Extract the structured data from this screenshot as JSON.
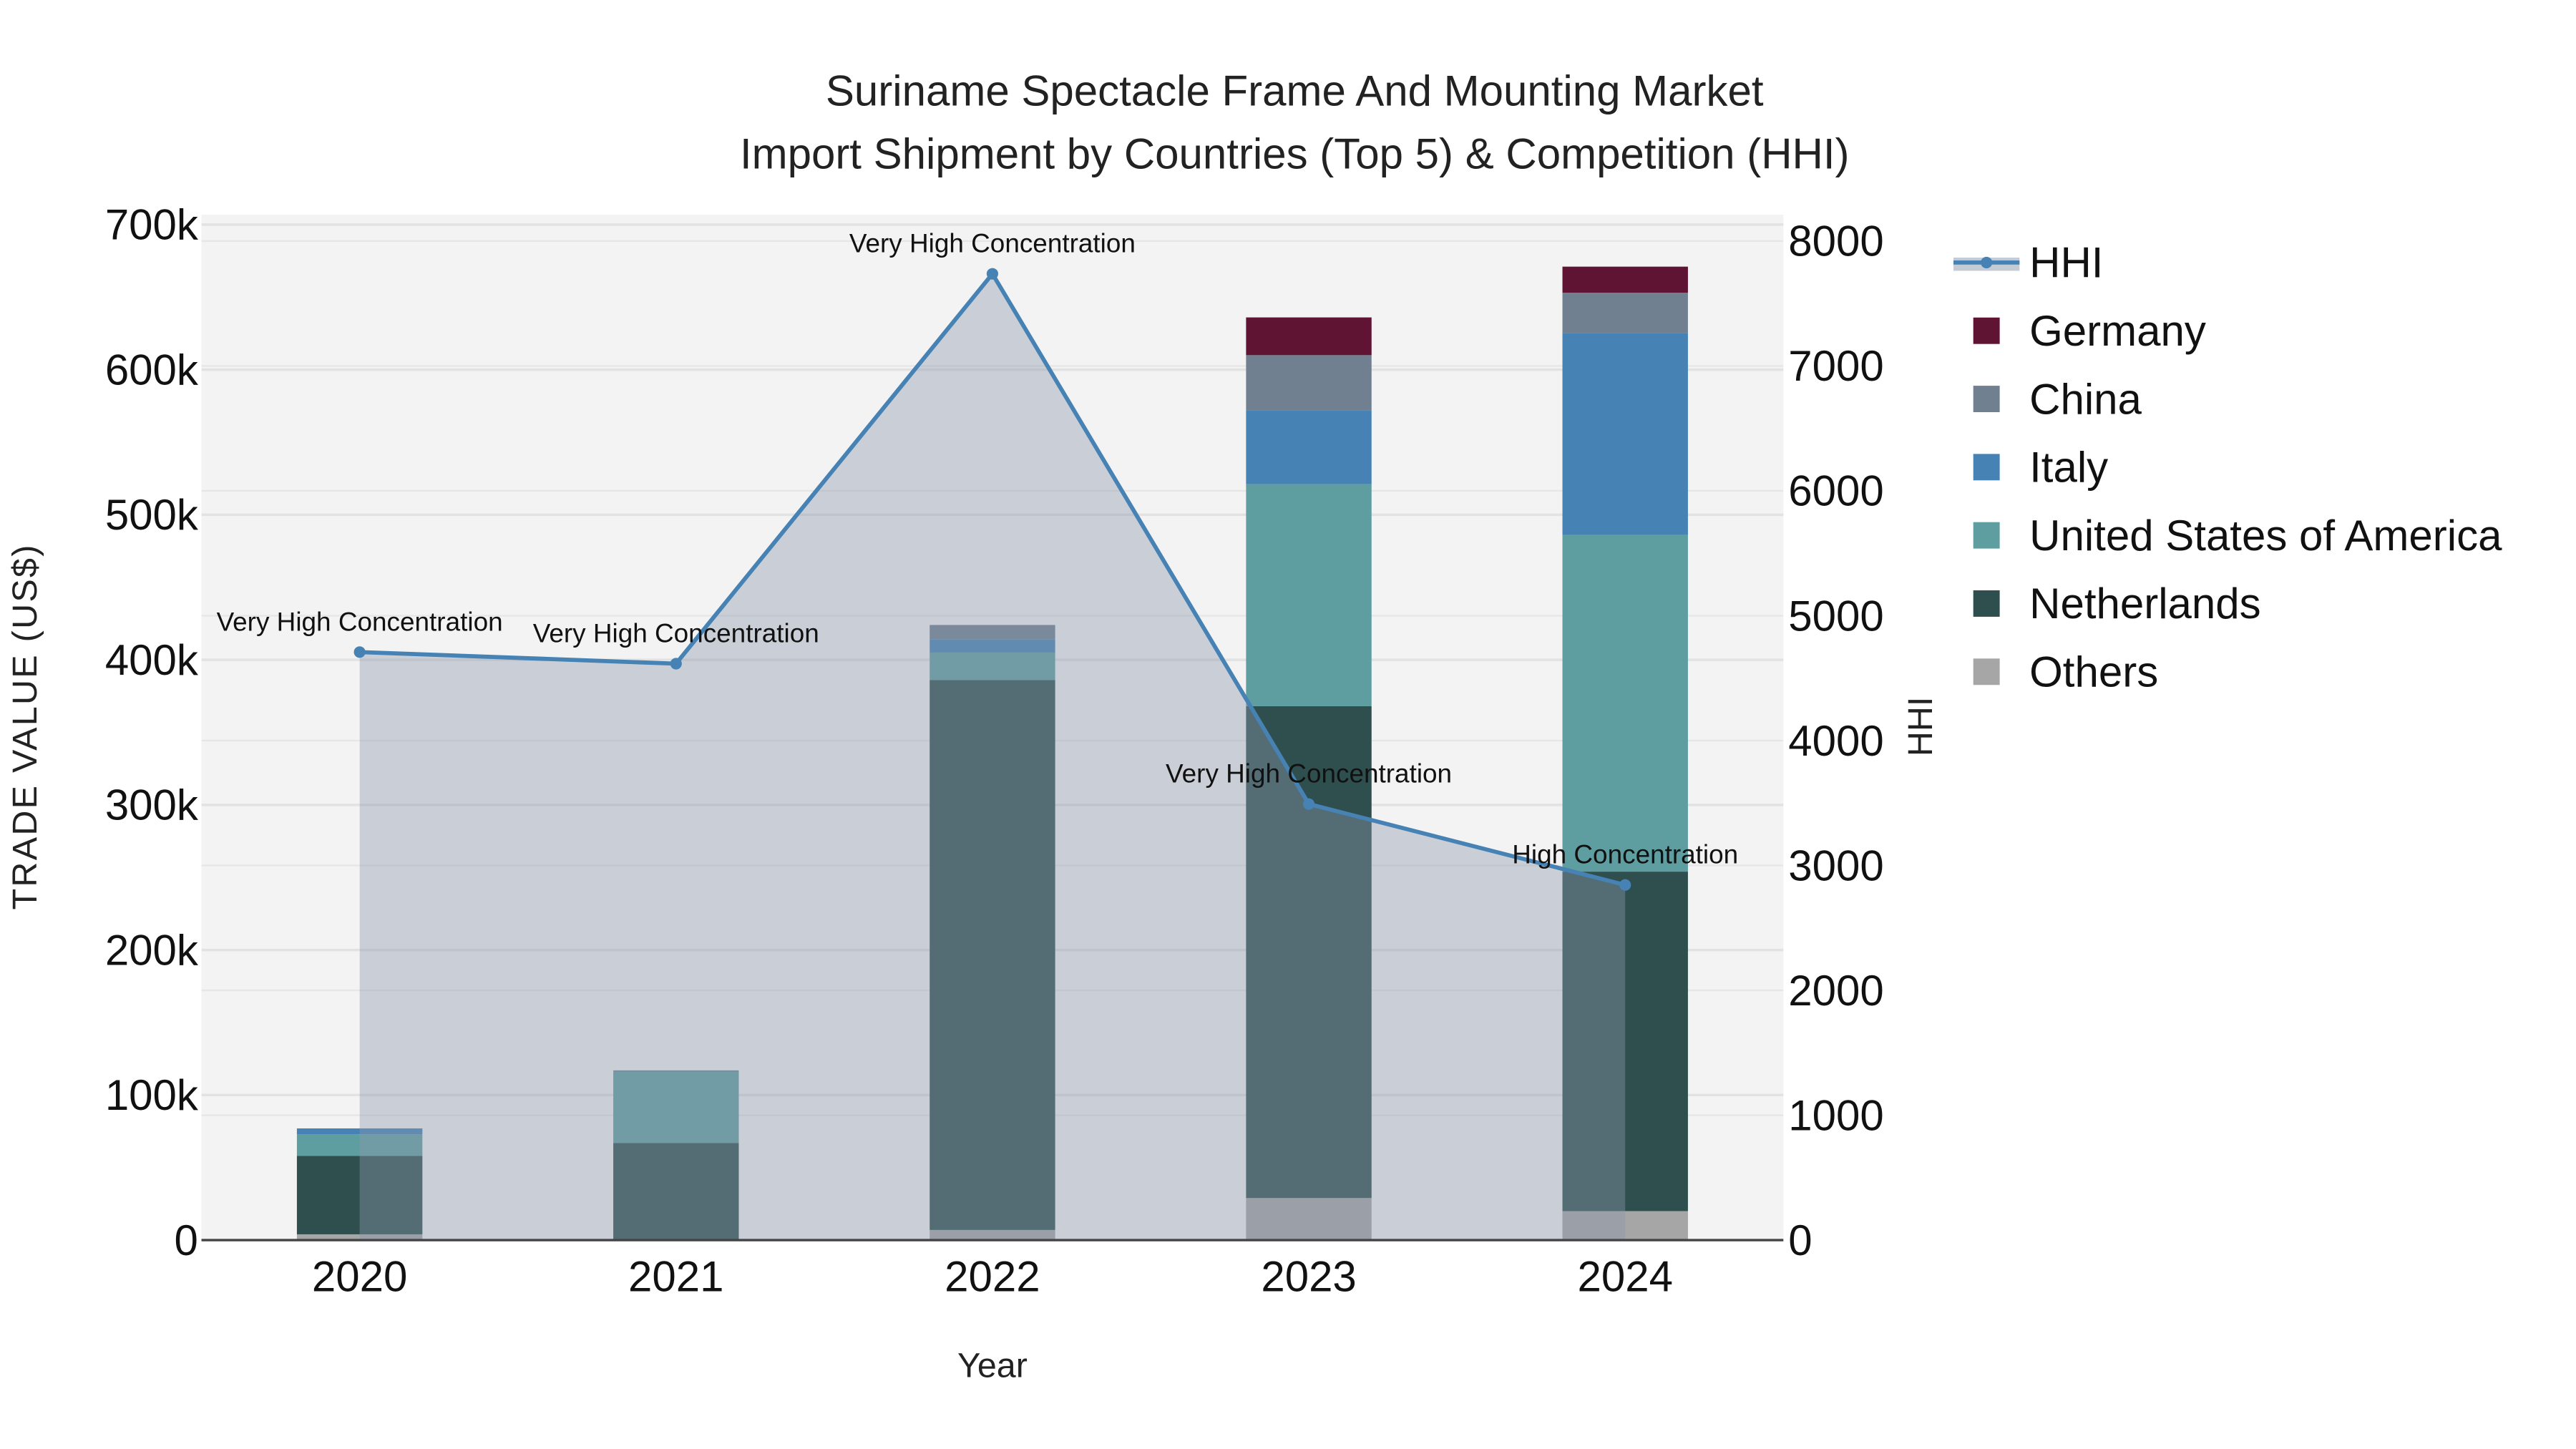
{
  "chart_data": {
    "type": "bar",
    "title_line1": "Suriname Spectacle Frame And Mounting Market",
    "title_line2": "Import Shipment by Countries (Top 5) & Competition (HHI)",
    "xlabel": "Year",
    "ylabel": "TRADE VALUE (US$)",
    "y2label": "HHI",
    "categories": [
      "2020",
      "2021",
      "2022",
      "2023",
      "2024"
    ],
    "ylim": [
      0,
      700000
    ],
    "y2lim": [
      0,
      8000
    ],
    "yticks": [
      0,
      100000,
      200000,
      300000,
      400000,
      500000,
      600000,
      700000
    ],
    "ytick_labels": [
      "0",
      "100k",
      "200k",
      "300k",
      "400k",
      "500k",
      "600k",
      "700k"
    ],
    "y2ticks": [
      0,
      1000,
      2000,
      3000,
      4000,
      5000,
      6000,
      7000,
      8000
    ],
    "y2tick_labels": [
      "0",
      "1000",
      "2000",
      "3000",
      "4000",
      "5000",
      "6000",
      "7000",
      "8000"
    ],
    "stacked": true,
    "series": [
      {
        "name": "Others",
        "color": "#a6a6a6",
        "values": [
          4000,
          0,
          7000,
          29000,
          20000
        ]
      },
      {
        "name": "Netherlands",
        "color": "#2f4f4f",
        "values": [
          54000,
          67000,
          379000,
          339000,
          234000
        ]
      },
      {
        "name": "United States of America",
        "color": "#5f9ea0",
        "values": [
          15000,
          49000,
          19000,
          153000,
          232000
        ]
      },
      {
        "name": "Italy",
        "color": "#4682b4",
        "values": [
          4000,
          0,
          9000,
          51000,
          139000
        ]
      },
      {
        "name": "China",
        "color": "#708090",
        "values": [
          0,
          1000,
          10000,
          38000,
          28000
        ]
      },
      {
        "name": "Germany",
        "color": "#601434",
        "values": [
          0,
          0,
          0,
          26000,
          18000
        ]
      }
    ],
    "hhi": {
      "name": "HHI",
      "color": "#4682b4",
      "values": [
        4709,
        4616,
        7738,
        3492,
        2844
      ],
      "annotations": [
        "Very High Concentration",
        "Very High Concentration",
        "Very High Concentration",
        "Very High Concentration",
        "High Concentration"
      ]
    },
    "legend_order": [
      "HHI",
      "Germany",
      "China",
      "Italy",
      "United States of America",
      "Netherlands",
      "Others"
    ],
    "legend_position": "right",
    "grid": true
  }
}
